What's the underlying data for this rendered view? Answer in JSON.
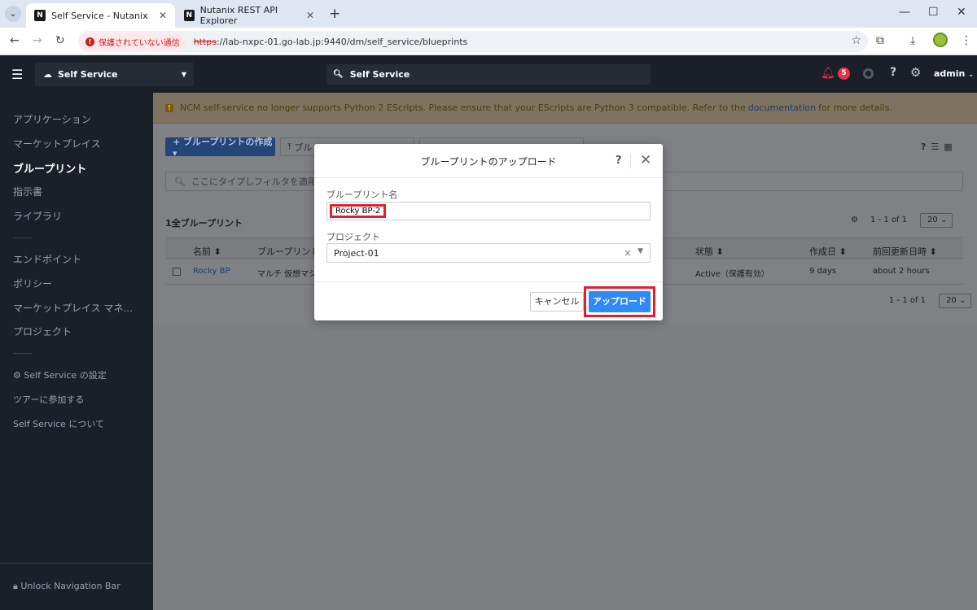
{
  "browser": {
    "tabs": [
      {
        "title": "Self Service - Nutanix",
        "active": true
      },
      {
        "title": "Nutanix REST API Explorer",
        "active": false
      }
    ],
    "security_label": "保護されていない通信",
    "url_scheme": "https",
    "url_rest": "://lab-nxpc-01.go-lab.jp:9440/dm/self_service/blueprints"
  },
  "topbar": {
    "app_name": "Self Service",
    "search_text": "Self Service",
    "notification_count": "5",
    "user": "admin"
  },
  "sidebar": {
    "items": [
      {
        "label": "アプリケーション"
      },
      {
        "label": "マーケットプレイス"
      },
      {
        "label": "ブループリント",
        "selected": true
      },
      {
        "label": "指示書"
      },
      {
        "label": "ライブラリ"
      },
      {
        "label": "エンドポイント"
      },
      {
        "label": "ポリシー"
      },
      {
        "label": "マーケットプレイス マネ..."
      },
      {
        "label": "プロジェクト"
      },
      {
        "label": "Self Service の設定"
      },
      {
        "label": "ツアーに参加する"
      },
      {
        "label": "Self Service について"
      }
    ],
    "unlock_label": "Unlock Navigation Bar"
  },
  "banner": {
    "text_before": "NCM self-service no longer supports Python 2 EScripts. Please ensure that your EScripts are Python 3 compatible. Refer to the",
    "link": "documentation",
    "text_after": "for more details."
  },
  "page": {
    "create_button": "+ ブループリントの作成 ▾",
    "upload_button": "ブル",
    "filter_placeholder": "ここにタイプしフィルタを適用して",
    "count_label": "1全ブループリント",
    "pager_range": "1 - 1 of 1",
    "page_size": "20",
    "columns": [
      "名前 ⬍",
      "ブループリントt",
      "状態 ⬍",
      "作成日 ⬍",
      "前回更新日時 ⬍"
    ],
    "rows": [
      {
        "name": "Rocky BP",
        "type": "マルチ 仮想マシ",
        "state": "Active（保護有効）",
        "created": "9 days",
        "updated": "about 2 hours"
      }
    ]
  },
  "modal": {
    "title": "ブループリントのアップロード",
    "name_label": "ブループリント名",
    "name_value": "Rocky BP-2",
    "project_label": "プロジェクト",
    "project_value": "Project-01",
    "cancel": "キャンセル",
    "upload": "アップロード"
  },
  "colors": {
    "accent": "#2f8af5",
    "highlight": "#e0202e",
    "topbar": "#1b1f27"
  }
}
